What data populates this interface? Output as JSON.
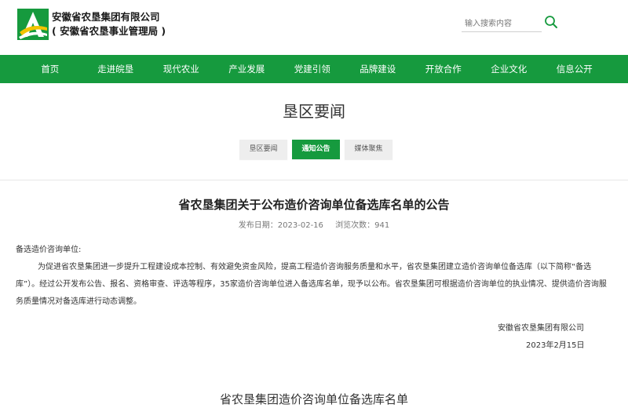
{
  "header": {
    "org_name_line1": "安徽省农垦集团有限公司",
    "org_name_line2": "( 安徽省农垦事业管理局 )",
    "search_placeholder": "输入搜索内容",
    "icons": {
      "logo": "a-letter-road-logo",
      "search": "search-icon"
    },
    "colors": {
      "logo_green": "#169a3e",
      "logo_yellow": "#f2c400"
    }
  },
  "nav": {
    "background": "#169a3e",
    "items": [
      "首页",
      "走进皖垦",
      "现代农业",
      "产业发展",
      "党建引领",
      "品牌建设",
      "开放合作",
      "企业文化",
      "信息公开"
    ]
  },
  "page": {
    "title": "垦区要闻",
    "tabs": [
      {
        "label": "垦区要闻",
        "active": false
      },
      {
        "label": "通知公告",
        "active": true
      },
      {
        "label": "媒体聚焦",
        "active": false
      }
    ]
  },
  "article": {
    "title": "省农垦集团关于公布造价咨询单位备选库名单的公告",
    "publish_date": "发布日期：2023-02-16",
    "views": "浏览次数：941",
    "salutation": "备选造价咨询单位:",
    "body": "为促进省农垦集团进一步提升工程建设成本控制、有效避免资金风险，提高工程造价咨询服务质量和水平，省农垦集团建立造价咨询单位备选库（以下简称“备选库”）。经过公开发布公告、报名、资格审查、评选等程序，35家造价咨询单位进入备选库名单，现予以公布。省农垦集团可根据造价咨询单位的执业情况、提供造价咨询服务质量情况对备选库进行动态调整。",
    "signature_org": "安徽省农垦集团有限公司",
    "signature_date": "2023年2月15日",
    "list_title": "省农垦集团造价咨询单位备选库名单"
  }
}
